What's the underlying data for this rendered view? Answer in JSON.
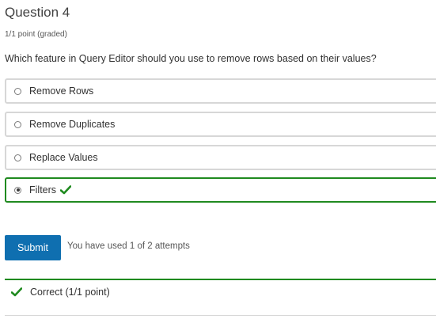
{
  "question": {
    "title": "Question 4",
    "points": "1/1 point (graded)",
    "prompt": "Which feature in Query Editor should you use to remove rows based on their values?"
  },
  "options": [
    {
      "label": "Remove Rows",
      "selected": false
    },
    {
      "label": "Remove Duplicates",
      "selected": false
    },
    {
      "label": "Replace Values",
      "selected": false
    },
    {
      "label": "Filters",
      "selected": true,
      "status": "correct"
    }
  ],
  "actions": {
    "submit_label": "Submit",
    "attempts_text": "You have used 1 of 2 attempts"
  },
  "feedback": {
    "text": "Correct (1/1 point)",
    "icon": "checkmark-icon"
  },
  "colors": {
    "correct": "#1f8a1f",
    "submit": "#0f6fb0",
    "border": "#d7d7d7"
  }
}
